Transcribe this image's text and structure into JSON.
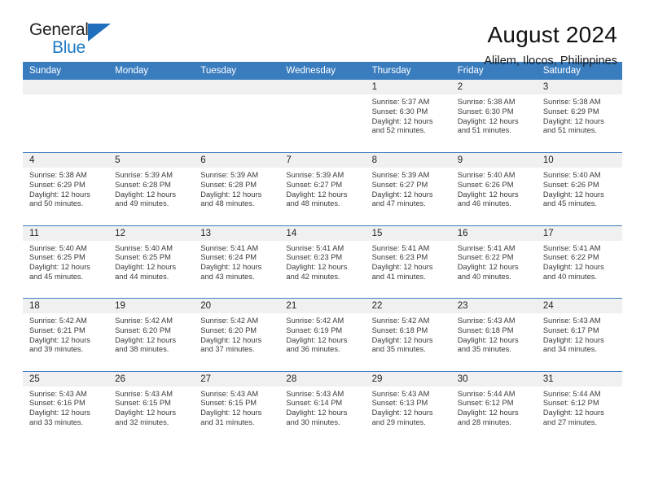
{
  "brand": {
    "name_part1": "General",
    "name_part2": "Blue",
    "triangle_color": "#1f6fbc",
    "blue_color": "#1f7ac4"
  },
  "header": {
    "title": "August 2024",
    "subtitle": "Alilem, Ilocos, Philippines"
  },
  "theme": {
    "header_row_bg": "#3a7dbf",
    "header_row_text": "#ffffff",
    "daynum_band_bg": "#f0f0f0",
    "row_divider": "#3a7dbf",
    "body_text": "#3a3a3a"
  },
  "weekday_headers": [
    "Sunday",
    "Monday",
    "Tuesday",
    "Wednesday",
    "Thursday",
    "Friday",
    "Saturday"
  ],
  "weeks": [
    [
      {
        "day": "",
        "sunrise": "",
        "sunset": "",
        "daylight_line1": "",
        "daylight_line2": ""
      },
      {
        "day": "",
        "sunrise": "",
        "sunset": "",
        "daylight_line1": "",
        "daylight_line2": ""
      },
      {
        "day": "",
        "sunrise": "",
        "sunset": "",
        "daylight_line1": "",
        "daylight_line2": ""
      },
      {
        "day": "",
        "sunrise": "",
        "sunset": "",
        "daylight_line1": "",
        "daylight_line2": ""
      },
      {
        "day": "1",
        "sunrise": "Sunrise: 5:37 AM",
        "sunset": "Sunset: 6:30 PM",
        "daylight_line1": "Daylight: 12 hours",
        "daylight_line2": "and 52 minutes."
      },
      {
        "day": "2",
        "sunrise": "Sunrise: 5:38 AM",
        "sunset": "Sunset: 6:30 PM",
        "daylight_line1": "Daylight: 12 hours",
        "daylight_line2": "and 51 minutes."
      },
      {
        "day": "3",
        "sunrise": "Sunrise: 5:38 AM",
        "sunset": "Sunset: 6:29 PM",
        "daylight_line1": "Daylight: 12 hours",
        "daylight_line2": "and 51 minutes."
      }
    ],
    [
      {
        "day": "4",
        "sunrise": "Sunrise: 5:38 AM",
        "sunset": "Sunset: 6:29 PM",
        "daylight_line1": "Daylight: 12 hours",
        "daylight_line2": "and 50 minutes."
      },
      {
        "day": "5",
        "sunrise": "Sunrise: 5:39 AM",
        "sunset": "Sunset: 6:28 PM",
        "daylight_line1": "Daylight: 12 hours",
        "daylight_line2": "and 49 minutes."
      },
      {
        "day": "6",
        "sunrise": "Sunrise: 5:39 AM",
        "sunset": "Sunset: 6:28 PM",
        "daylight_line1": "Daylight: 12 hours",
        "daylight_line2": "and 48 minutes."
      },
      {
        "day": "7",
        "sunrise": "Sunrise: 5:39 AM",
        "sunset": "Sunset: 6:27 PM",
        "daylight_line1": "Daylight: 12 hours",
        "daylight_line2": "and 48 minutes."
      },
      {
        "day": "8",
        "sunrise": "Sunrise: 5:39 AM",
        "sunset": "Sunset: 6:27 PM",
        "daylight_line1": "Daylight: 12 hours",
        "daylight_line2": "and 47 minutes."
      },
      {
        "day": "9",
        "sunrise": "Sunrise: 5:40 AM",
        "sunset": "Sunset: 6:26 PM",
        "daylight_line1": "Daylight: 12 hours",
        "daylight_line2": "and 46 minutes."
      },
      {
        "day": "10",
        "sunrise": "Sunrise: 5:40 AM",
        "sunset": "Sunset: 6:26 PM",
        "daylight_line1": "Daylight: 12 hours",
        "daylight_line2": "and 45 minutes."
      }
    ],
    [
      {
        "day": "11",
        "sunrise": "Sunrise: 5:40 AM",
        "sunset": "Sunset: 6:25 PM",
        "daylight_line1": "Daylight: 12 hours",
        "daylight_line2": "and 45 minutes."
      },
      {
        "day": "12",
        "sunrise": "Sunrise: 5:40 AM",
        "sunset": "Sunset: 6:25 PM",
        "daylight_line1": "Daylight: 12 hours",
        "daylight_line2": "and 44 minutes."
      },
      {
        "day": "13",
        "sunrise": "Sunrise: 5:41 AM",
        "sunset": "Sunset: 6:24 PM",
        "daylight_line1": "Daylight: 12 hours",
        "daylight_line2": "and 43 minutes."
      },
      {
        "day": "14",
        "sunrise": "Sunrise: 5:41 AM",
        "sunset": "Sunset: 6:23 PM",
        "daylight_line1": "Daylight: 12 hours",
        "daylight_line2": "and 42 minutes."
      },
      {
        "day": "15",
        "sunrise": "Sunrise: 5:41 AM",
        "sunset": "Sunset: 6:23 PM",
        "daylight_line1": "Daylight: 12 hours",
        "daylight_line2": "and 41 minutes."
      },
      {
        "day": "16",
        "sunrise": "Sunrise: 5:41 AM",
        "sunset": "Sunset: 6:22 PM",
        "daylight_line1": "Daylight: 12 hours",
        "daylight_line2": "and 40 minutes."
      },
      {
        "day": "17",
        "sunrise": "Sunrise: 5:41 AM",
        "sunset": "Sunset: 6:22 PM",
        "daylight_line1": "Daylight: 12 hours",
        "daylight_line2": "and 40 minutes."
      }
    ],
    [
      {
        "day": "18",
        "sunrise": "Sunrise: 5:42 AM",
        "sunset": "Sunset: 6:21 PM",
        "daylight_line1": "Daylight: 12 hours",
        "daylight_line2": "and 39 minutes."
      },
      {
        "day": "19",
        "sunrise": "Sunrise: 5:42 AM",
        "sunset": "Sunset: 6:20 PM",
        "daylight_line1": "Daylight: 12 hours",
        "daylight_line2": "and 38 minutes."
      },
      {
        "day": "20",
        "sunrise": "Sunrise: 5:42 AM",
        "sunset": "Sunset: 6:20 PM",
        "daylight_line1": "Daylight: 12 hours",
        "daylight_line2": "and 37 minutes."
      },
      {
        "day": "21",
        "sunrise": "Sunrise: 5:42 AM",
        "sunset": "Sunset: 6:19 PM",
        "daylight_line1": "Daylight: 12 hours",
        "daylight_line2": "and 36 minutes."
      },
      {
        "day": "22",
        "sunrise": "Sunrise: 5:42 AM",
        "sunset": "Sunset: 6:18 PM",
        "daylight_line1": "Daylight: 12 hours",
        "daylight_line2": "and 35 minutes."
      },
      {
        "day": "23",
        "sunrise": "Sunrise: 5:43 AM",
        "sunset": "Sunset: 6:18 PM",
        "daylight_line1": "Daylight: 12 hours",
        "daylight_line2": "and 35 minutes."
      },
      {
        "day": "24",
        "sunrise": "Sunrise: 5:43 AM",
        "sunset": "Sunset: 6:17 PM",
        "daylight_line1": "Daylight: 12 hours",
        "daylight_line2": "and 34 minutes."
      }
    ],
    [
      {
        "day": "25",
        "sunrise": "Sunrise: 5:43 AM",
        "sunset": "Sunset: 6:16 PM",
        "daylight_line1": "Daylight: 12 hours",
        "daylight_line2": "and 33 minutes."
      },
      {
        "day": "26",
        "sunrise": "Sunrise: 5:43 AM",
        "sunset": "Sunset: 6:15 PM",
        "daylight_line1": "Daylight: 12 hours",
        "daylight_line2": "and 32 minutes."
      },
      {
        "day": "27",
        "sunrise": "Sunrise: 5:43 AM",
        "sunset": "Sunset: 6:15 PM",
        "daylight_line1": "Daylight: 12 hours",
        "daylight_line2": "and 31 minutes."
      },
      {
        "day": "28",
        "sunrise": "Sunrise: 5:43 AM",
        "sunset": "Sunset: 6:14 PM",
        "daylight_line1": "Daylight: 12 hours",
        "daylight_line2": "and 30 minutes."
      },
      {
        "day": "29",
        "sunrise": "Sunrise: 5:43 AM",
        "sunset": "Sunset: 6:13 PM",
        "daylight_line1": "Daylight: 12 hours",
        "daylight_line2": "and 29 minutes."
      },
      {
        "day": "30",
        "sunrise": "Sunrise: 5:44 AM",
        "sunset": "Sunset: 6:12 PM",
        "daylight_line1": "Daylight: 12 hours",
        "daylight_line2": "and 28 minutes."
      },
      {
        "day": "31",
        "sunrise": "Sunrise: 5:44 AM",
        "sunset": "Sunset: 6:12 PM",
        "daylight_line1": "Daylight: 12 hours",
        "daylight_line2": "and 27 minutes."
      }
    ]
  ]
}
